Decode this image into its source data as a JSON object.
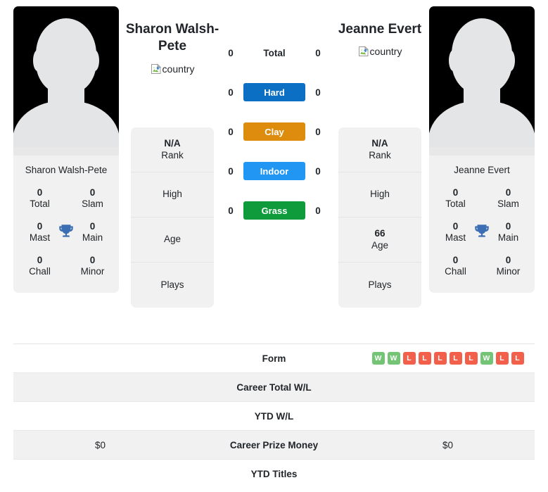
{
  "players": {
    "left": {
      "name": "Sharon Walsh-Pete",
      "card_name": "Sharon Walsh-Pete",
      "flag_alt": "country",
      "titles": [
        {
          "num": "0",
          "label": "Total"
        },
        {
          "num": "0",
          "label": "Slam"
        },
        {
          "num": "0",
          "label": "Mast"
        },
        {
          "num": "0",
          "label": "Main"
        },
        {
          "num": "0",
          "label": "Chall"
        },
        {
          "num": "0",
          "label": "Minor"
        }
      ],
      "info": [
        {
          "value": "N/A",
          "label": "Rank"
        },
        {
          "value": "",
          "label": "High"
        },
        {
          "value": "",
          "label": "Age"
        },
        {
          "value": "",
          "label": "Plays"
        }
      ]
    },
    "right": {
      "name": "Jeanne Evert",
      "card_name": "Jeanne Evert",
      "flag_alt": "country",
      "titles": [
        {
          "num": "0",
          "label": "Total"
        },
        {
          "num": "0",
          "label": "Slam"
        },
        {
          "num": "0",
          "label": "Mast"
        },
        {
          "num": "0",
          "label": "Main"
        },
        {
          "num": "0",
          "label": "Chall"
        },
        {
          "num": "0",
          "label": "Minor"
        }
      ],
      "info": [
        {
          "value": "N/A",
          "label": "Rank"
        },
        {
          "value": "",
          "label": "High"
        },
        {
          "value": "66",
          "label": "Age"
        },
        {
          "value": "",
          "label": "Plays"
        }
      ]
    }
  },
  "surfaces": [
    {
      "left": "0",
      "label": "Total",
      "right": "0",
      "badge": false,
      "color": ""
    },
    {
      "left": "0",
      "label": "Hard",
      "right": "0",
      "badge": true,
      "color": "#0b6fc4"
    },
    {
      "left": "0",
      "label": "Clay",
      "right": "0",
      "badge": true,
      "color": "#dd8c0e"
    },
    {
      "left": "0",
      "label": "Indoor",
      "right": "0",
      "badge": true,
      "color": "#2196f3"
    },
    {
      "left": "0",
      "label": "Grass",
      "right": "0",
      "badge": true,
      "color": "#0f9b3c"
    }
  ],
  "stats_table": [
    {
      "label": "Form",
      "left_value": "",
      "right_value": "",
      "right_form": [
        "W",
        "W",
        "L",
        "L",
        "L",
        "L",
        "L",
        "W",
        "L",
        "L"
      ],
      "striped": false
    },
    {
      "label": "Career Total W/L",
      "left_value": "",
      "right_value": "",
      "striped": true
    },
    {
      "label": "YTD W/L",
      "left_value": "",
      "right_value": "",
      "striped": false
    },
    {
      "label": "Career Prize Money",
      "left_value": "$0",
      "right_value": "$0",
      "striped": true
    },
    {
      "label": "YTD Titles",
      "left_value": "",
      "right_value": "",
      "striped": false
    }
  ],
  "colors": {
    "form_win": "#74c476",
    "form_loss": "#f2604c",
    "trophy": "#3c6eb4",
    "card_bg": "#f1f1f1"
  },
  "icons": {
    "trophy": "trophy-icon",
    "broken_image": "broken-image-icon"
  }
}
